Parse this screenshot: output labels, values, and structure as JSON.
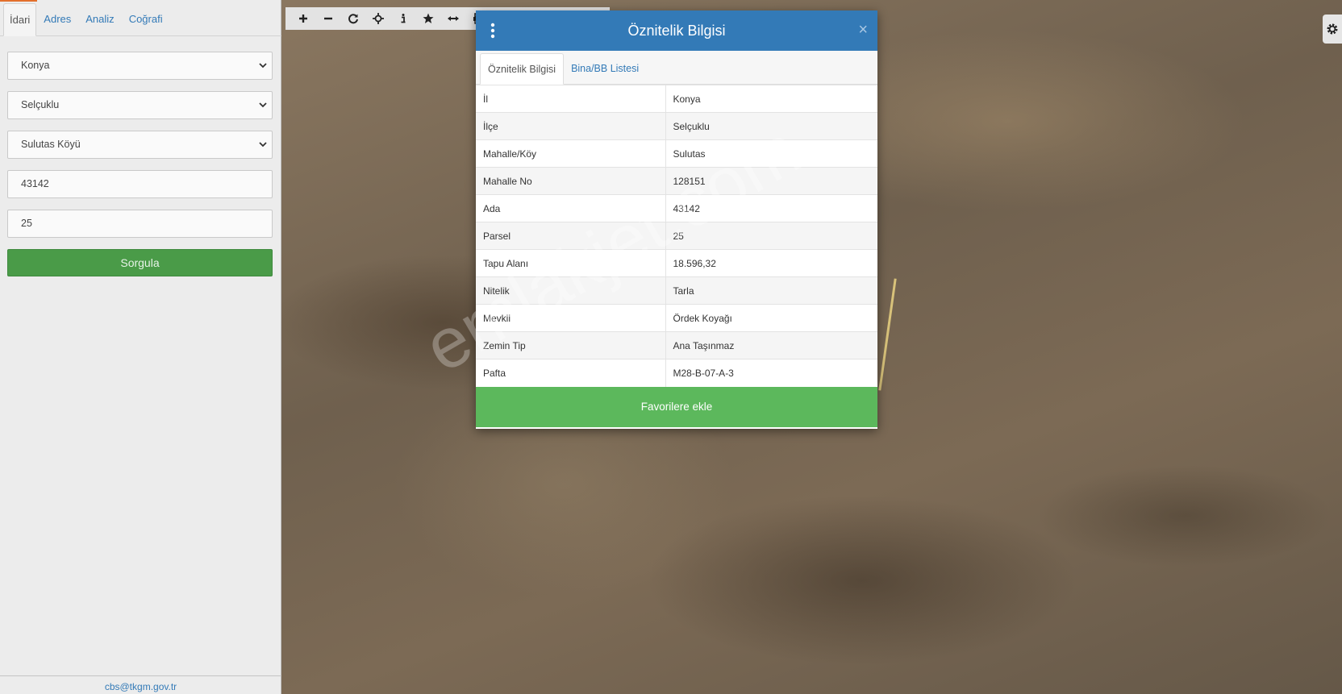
{
  "left_panel": {
    "tabs": [
      {
        "label": "İdari",
        "active": true
      },
      {
        "label": "Adres",
        "active": false
      },
      {
        "label": "Analiz",
        "active": false
      },
      {
        "label": "Coğrafi",
        "active": false
      }
    ],
    "province_select": {
      "value": "Konya"
    },
    "district_select": {
      "value": "Selçuklu"
    },
    "neighborhood_select": {
      "value": "Sulutas Köyü"
    },
    "block_input": {
      "value": "43142"
    },
    "parcel_input": {
      "value": "25"
    },
    "query_button": {
      "label": "Sorgula"
    },
    "footer_email": "cbs@tkgm.gov.tr"
  },
  "map": {
    "tools": [
      {
        "icon": "zoom-in-icon",
        "glyph": "+"
      },
      {
        "icon": "zoom-out-icon",
        "glyph": "−"
      },
      {
        "icon": "refresh-icon",
        "glyph": "⟳"
      },
      {
        "icon": "crosshair-icon",
        "glyph": "✥"
      },
      {
        "icon": "info-icon",
        "glyph": "i"
      },
      {
        "icon": "star-icon",
        "glyph": "★"
      },
      {
        "icon": "measure-icon",
        "glyph": "⟷"
      },
      {
        "icon": "print-icon",
        "glyph": "⎙"
      }
    ],
    "settings_icon": "gear-icon"
  },
  "modal": {
    "title": "Öznitelik Bilgisi",
    "tabs": [
      {
        "label": "Öznitelik Bilgisi",
        "active": true
      },
      {
        "label": "Bina/BB Listesi",
        "active": false
      }
    ],
    "rows": [
      {
        "key": "İl",
        "value": "Konya"
      },
      {
        "key": "İlçe",
        "value": "Selçuklu"
      },
      {
        "key": "Mahalle/Köy",
        "value": "Sulutas"
      },
      {
        "key": "Mahalle No",
        "value": "128151"
      },
      {
        "key": "Ada",
        "value": "43142"
      },
      {
        "key": "Parsel",
        "value": "25"
      },
      {
        "key": "Tapu Alanı",
        "value": "18.596,32"
      },
      {
        "key": "Nitelik",
        "value": "Tarla"
      },
      {
        "key": "Mevkii",
        "value": "Ördek Koyağı"
      },
      {
        "key": "Zemin Tip",
        "value": "Ana Taşınmaz"
      },
      {
        "key": "Pafta",
        "value": "M28-B-07-A-3"
      }
    ],
    "favorite_button": "Favorilere ekle",
    "close_glyph": "×"
  },
  "watermark": "emlakjet.com",
  "colors": {
    "header_blue": "#337ab7",
    "favorite_green": "#5cb85c",
    "query_green": "#4a9b48",
    "accent_orange": "#e36f2c"
  }
}
